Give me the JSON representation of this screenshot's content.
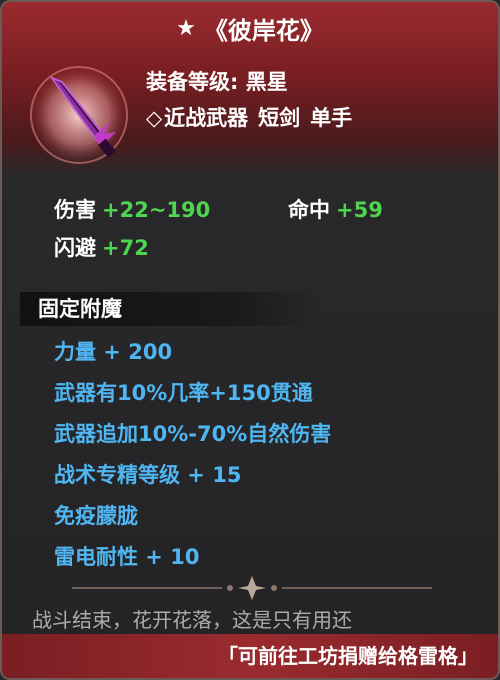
{
  "tooltip": {
    "title": "《彼岸花》",
    "title_icon": "star-icon",
    "item_icon": "purple-dagger-icon",
    "equip_level": "装备等级: 黑星",
    "type_prefix": "◇",
    "type_parts": [
      "近战武器",
      "短剑",
      "单手"
    ],
    "stats": {
      "damage_label": "伤害",
      "damage_value": "+22~190",
      "accuracy_label": "命中",
      "accuracy_value": "+59",
      "evasion_label": "闪避",
      "evasion_value": "+72"
    },
    "enchant_section_title": "固定附魔",
    "enchants": [
      "力量 + 200",
      "武器有10%几率+150贯通",
      "武器追加10%-70%自然伤害",
      "战术专精等级 + 15",
      "免疫朦胧",
      "雷电耐性 + 10"
    ],
    "flavor_text": "战斗结束，花开花落，这是只有用还",
    "footer_text": "「可前往工坊捐赠给格雷格」"
  },
  "colors": {
    "header_red": "#9a2b2f",
    "stat_green": "#4fd44f",
    "enchant_blue": "#4fb6f2"
  }
}
